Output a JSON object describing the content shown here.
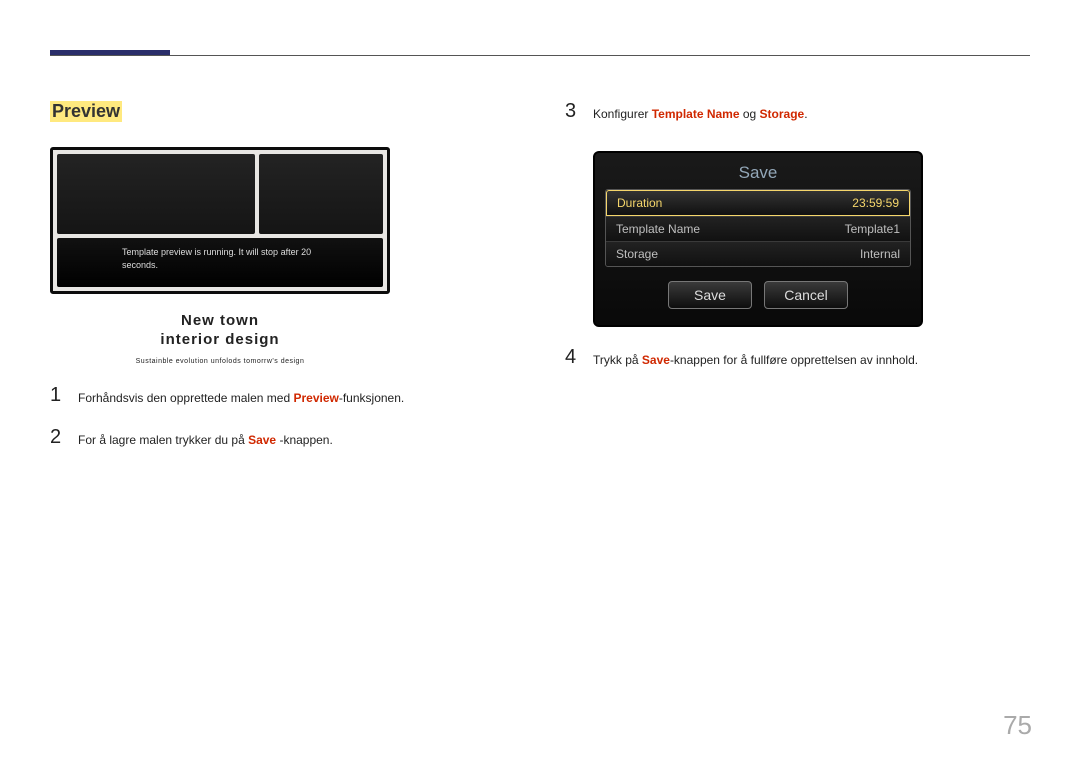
{
  "section_title": "Preview",
  "preview_banner": "Template preview is running. It will stop after 20 seconds.",
  "preview_caption": {
    "line1": "New town",
    "line2": "interior design",
    "line3": "Sustainble evolution unfolods tomorrw's design"
  },
  "steps_left": [
    {
      "num": "1",
      "parts": [
        "Forhåndsvis den opprettede malen med ",
        "Preview",
        "-funksjonen."
      ]
    },
    {
      "num": "2",
      "parts": [
        "For å lagre malen trykker du på ",
        "Save",
        " -knappen."
      ]
    }
  ],
  "steps_right": [
    {
      "num": "3",
      "parts": [
        "Konfigurer ",
        "Template Name",
        " og ",
        "Storage",
        "."
      ]
    },
    {
      "num": "4",
      "parts": [
        "Trykk på ",
        "Save",
        "-knappen for å fullføre opprettelsen av innhold."
      ]
    }
  ],
  "save_dialog": {
    "title": "Save",
    "rows": [
      {
        "label": "Duration",
        "value": "23:59:59",
        "selected": true
      },
      {
        "label": "Template Name",
        "value": "Template1",
        "selected": false
      },
      {
        "label": "Storage",
        "value": "Internal",
        "selected": false
      }
    ],
    "buttons": {
      "save": "Save",
      "cancel": "Cancel"
    }
  },
  "page_number": "75"
}
